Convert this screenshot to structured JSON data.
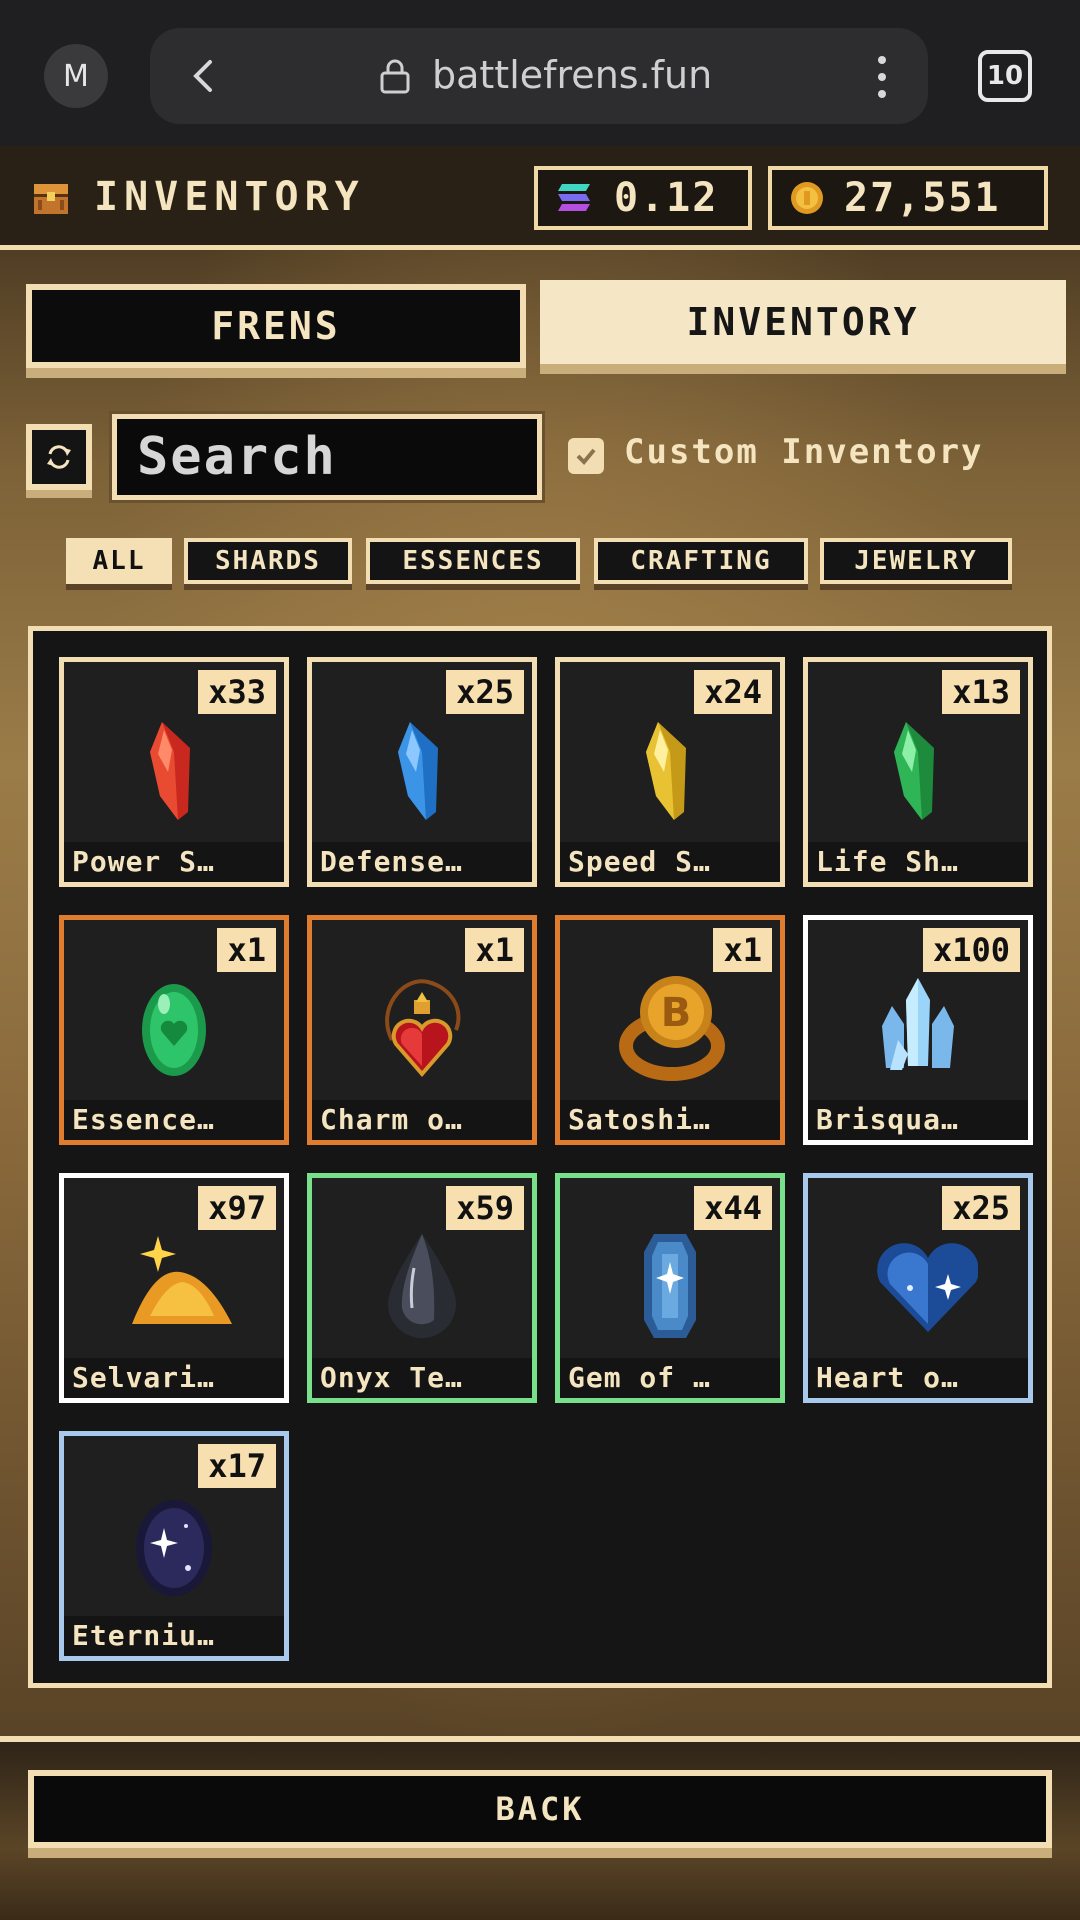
{
  "browser": {
    "avatar_letter": "M",
    "url": "battlefrens.fun",
    "tab_count": "10"
  },
  "header": {
    "title": "INVENTORY",
    "sol_balance": "0.12",
    "coin_balance": "27,551"
  },
  "tabs": {
    "frens": "FRENS",
    "inventory": "INVENTORY",
    "active": "inventory"
  },
  "search": {
    "placeholder": "Search",
    "custom_inventory_label": "Custom Inventory",
    "custom_inventory_checked": true
  },
  "filters": {
    "all": "ALL",
    "shards": "SHARDS",
    "essences": "ESSENCES",
    "crafting": "CRAFTING",
    "jewelry": "JEWELRY",
    "active": "all"
  },
  "items": [
    {
      "name": "Power S…",
      "count": "x33",
      "border": "#f2deb2",
      "icon": "red-shard-icon"
    },
    {
      "name": "Defense…",
      "count": "x25",
      "border": "#f2deb2",
      "icon": "blue-shard-icon"
    },
    {
      "name": "Speed S…",
      "count": "x24",
      "border": "#f2deb2",
      "icon": "yellow-shard-icon"
    },
    {
      "name": "Life Sh…",
      "count": "x13",
      "border": "#f2deb2",
      "icon": "green-shard-icon"
    },
    {
      "name": "Essence…",
      "count": "x1",
      "border": "#e07c2e",
      "icon": "green-heart-gem-icon"
    },
    {
      "name": "Charm o…",
      "count": "x1",
      "border": "#e07c2e",
      "icon": "heart-charm-icon"
    },
    {
      "name": "Satoshi…",
      "count": "x1",
      "border": "#e07c2e",
      "icon": "bitcoin-ring-icon"
    },
    {
      "name": "Brisqua…",
      "count": "x100",
      "border": "#ffffff",
      "icon": "ice-crystal-icon"
    },
    {
      "name": "Selvari…",
      "count": "x97",
      "border": "#ffffff",
      "icon": "gold-dust-icon"
    },
    {
      "name": "Onyx Te…",
      "count": "x59",
      "border": "#78e08a",
      "icon": "onyx-tear-icon"
    },
    {
      "name": "Gem of …",
      "count": "x44",
      "border": "#78e08a",
      "icon": "blue-gem-icon"
    },
    {
      "name": "Heart o…",
      "count": "x25",
      "border": "#a8c8ec",
      "icon": "blue-heart-icon"
    },
    {
      "name": "Eterniu…",
      "count": "x17",
      "border": "#a8c8ec",
      "icon": "galaxy-orb-icon"
    }
  ],
  "footer": {
    "back_label": "BACK"
  }
}
